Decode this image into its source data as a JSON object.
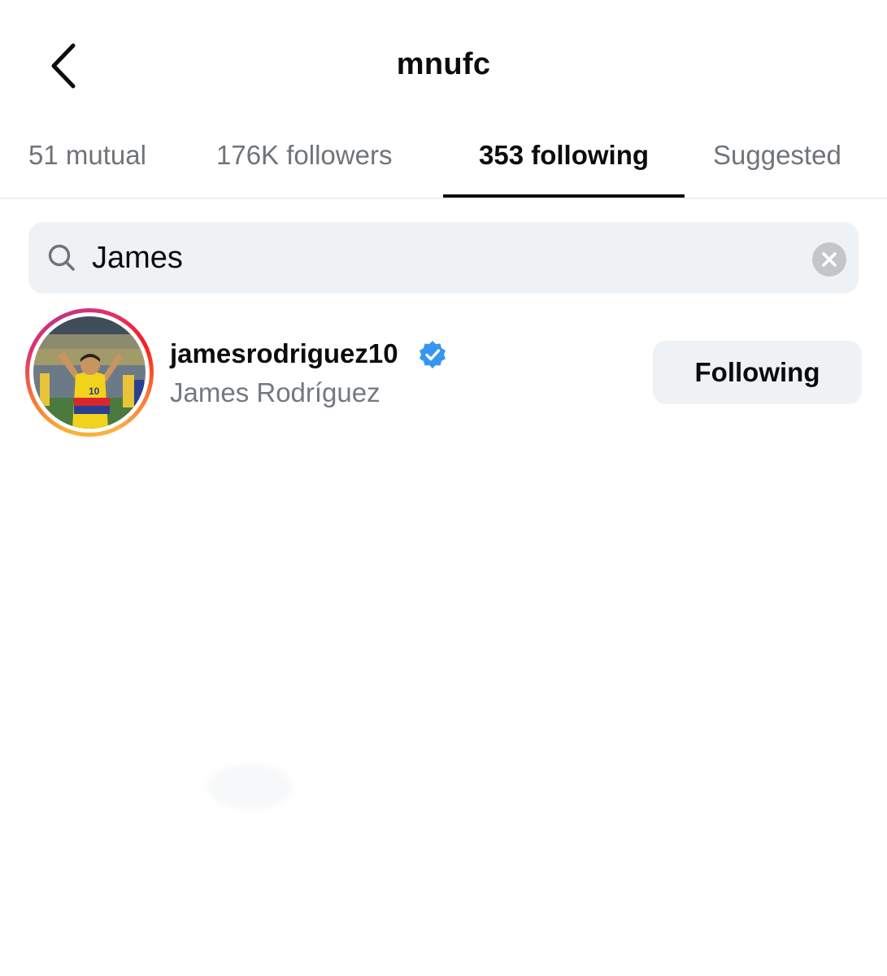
{
  "header": {
    "title": "mnufc",
    "back_icon": "chevron-left-icon"
  },
  "tabs": [
    {
      "label": "51 mutual",
      "active": false
    },
    {
      "label": "176K followers",
      "active": false
    },
    {
      "label": "353 following",
      "active": true
    },
    {
      "label": "Suggested",
      "active": false
    }
  ],
  "search": {
    "value": "James",
    "icon": "search-icon",
    "clear_icon": "clear-icon"
  },
  "results": [
    {
      "username": "jamesrodriguez10",
      "full_name": "James Rodríguez",
      "verified": true,
      "button_label": "Following",
      "has_story": true
    }
  ],
  "colors": {
    "verified_blue": "#3797f0",
    "secondary_text": "#737980",
    "button_bg": "#eff2f5",
    "active_tab": "#0c0c0c"
  }
}
